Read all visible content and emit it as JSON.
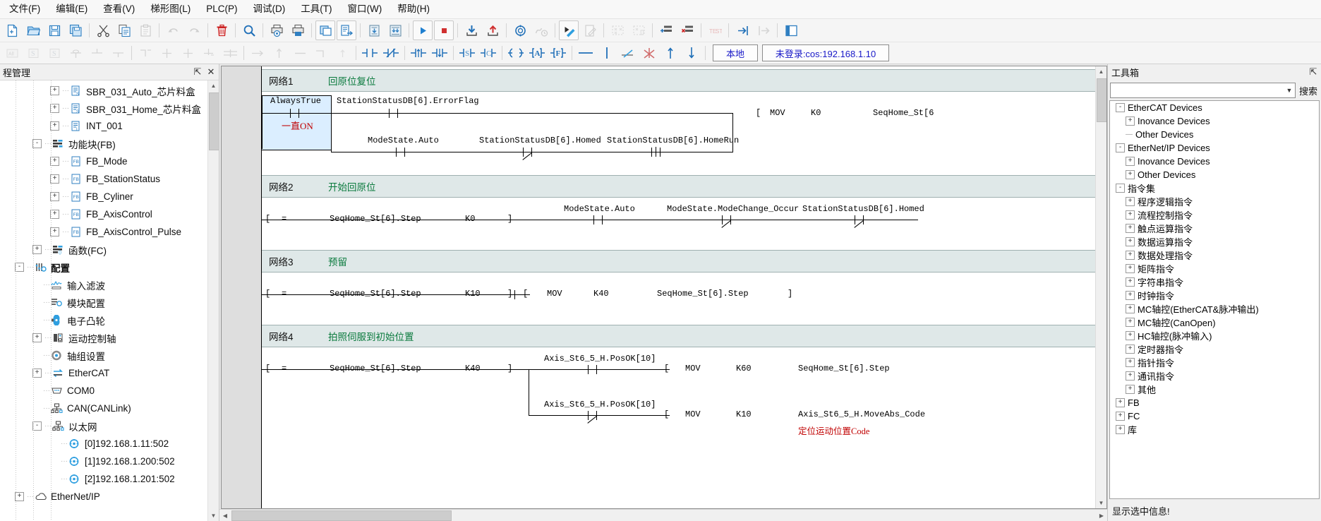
{
  "menu": {
    "items": [
      {
        "label": "文件(F)",
        "name": "menu-file"
      },
      {
        "label": "编辑(E)",
        "name": "menu-edit"
      },
      {
        "label": "查看(V)",
        "name": "menu-view"
      },
      {
        "label": "梯形图(L)",
        "name": "menu-ladder"
      },
      {
        "label": "PLC(P)",
        "name": "menu-plc"
      },
      {
        "label": "调试(D)",
        "name": "menu-debug"
      },
      {
        "label": "工具(T)",
        "name": "menu-tools"
      },
      {
        "label": "窗口(W)",
        "name": "menu-window"
      },
      {
        "label": "帮助(H)",
        "name": "menu-help"
      }
    ]
  },
  "status": {
    "local_label": "本地",
    "connection_label": "未登录:cos:192.168.1.10"
  },
  "left_panel": {
    "title": "程管理",
    "pin_glyph": "⇱",
    "close_glyph": "✕",
    "tree": [
      {
        "label": "SBR_031_Auto_芯片料盒",
        "indent": 3,
        "icon": "subroutine-icon",
        "expander": "+"
      },
      {
        "label": "SBR_031_Home_芯片料盒",
        "indent": 3,
        "icon": "subroutine-icon",
        "expander": "+"
      },
      {
        "label": "INT_001",
        "indent": 3,
        "icon": "interrupt-icon",
        "expander": "+"
      },
      {
        "label": "功能块(FB)",
        "indent": 2,
        "icon": "folder-fb-icon",
        "expander": "-"
      },
      {
        "label": "FB_Mode",
        "indent": 3,
        "icon": "fb-icon",
        "expander": "+"
      },
      {
        "label": "FB_StationStatus",
        "indent": 3,
        "icon": "fb-icon",
        "expander": "+"
      },
      {
        "label": "FB_Cyliner",
        "indent": 3,
        "icon": "fb-icon",
        "expander": "+"
      },
      {
        "label": "FB_AxisControl",
        "indent": 3,
        "icon": "fb-icon",
        "expander": "+"
      },
      {
        "label": "FB_AxisControl_Pulse",
        "indent": 3,
        "icon": "fb-icon",
        "expander": "+"
      },
      {
        "label": "函数(FC)",
        "indent": 2,
        "icon": "folder-fc-icon",
        "expander": "+"
      },
      {
        "label": "配置",
        "indent": 1,
        "icon": "config-icon",
        "expander": "-",
        "bold": true
      },
      {
        "label": "输入滤波",
        "indent": 2,
        "icon": "input-filter-icon",
        "expander": ""
      },
      {
        "label": "模块配置",
        "indent": 2,
        "icon": "module-config-icon",
        "expander": ""
      },
      {
        "label": "电子凸轮",
        "indent": 2,
        "icon": "ecam-icon",
        "expander": ""
      },
      {
        "label": "运动控制轴",
        "indent": 2,
        "icon": "motion-axis-icon",
        "expander": "+"
      },
      {
        "label": "轴组设置",
        "indent": 2,
        "icon": "axis-group-icon",
        "expander": ""
      },
      {
        "label": "EtherCAT",
        "indent": 2,
        "icon": "ethercat-icon",
        "expander": "+"
      },
      {
        "label": "COM0",
        "indent": 2,
        "icon": "serial-port-icon",
        "expander": ""
      },
      {
        "label": "CAN(CANLink)",
        "indent": 2,
        "icon": "can-icon",
        "expander": ""
      },
      {
        "label": "以太网",
        "indent": 2,
        "icon": "ethernet-icon",
        "expander": "-"
      },
      {
        "label": "[0]192.168.1.11:502",
        "indent": 3,
        "icon": "node-icon",
        "expander": ""
      },
      {
        "label": "[1]192.168.1.200:502",
        "indent": 3,
        "icon": "node-icon",
        "expander": ""
      },
      {
        "label": "[2]192.168.1.201:502",
        "indent": 3,
        "icon": "node-icon",
        "expander": ""
      },
      {
        "label": "EtherNet/IP",
        "indent": 1,
        "icon": "ethernetip-icon",
        "expander": "+"
      }
    ]
  },
  "ladder": {
    "networks": [
      {
        "name": "网络1",
        "comment": "回原位复位",
        "elements": {
          "contact_always": "AlwaysTrue",
          "contact_always_note": "一直ON",
          "contact2": "StationStatusDB[6].ErrorFlag",
          "coil_op": "MOV",
          "coil_k": "K0",
          "coil_dest": "SeqHome_St[6",
          "branch1": "ModeState.Auto",
          "branch2": "StationStatusDB[6].Homed",
          "branch3": "StationStatusDB[6].HomeRun"
        }
      },
      {
        "name": "网络2",
        "comment": "开始回原位",
        "elements": {
          "cmp_op": "=",
          "cmp_a": "SeqHome_St[6].Step",
          "cmp_b": "K0",
          "c1": "ModeState.Auto",
          "c2": "ModeState.ModeChange_Occur",
          "c3": "StationStatusDB[6].Homed"
        }
      },
      {
        "name": "网络3",
        "comment": "预留",
        "elements": {
          "cmp_op": "=",
          "cmp_a": "SeqHome_St[6].Step",
          "cmp_b": "K10",
          "mov": "MOV",
          "mov_k": "K40",
          "mov_dest": "SeqHome_St[6].Step"
        }
      },
      {
        "name": "网络4",
        "comment": "拍照伺服到初始位置",
        "elements": {
          "cmp_op": "=",
          "cmp_a": "SeqHome_St[6].Step",
          "cmp_b": "K40",
          "c1": "Axis_St6_5_H.PosOK[10]",
          "mov1": "MOV",
          "mov1_k": "K60",
          "mov1_dest": "SeqHome_St[6].Step",
          "c2": "Axis_St6_5_H.PosOK[10]",
          "mov2": "MOV",
          "mov2_k": "K10",
          "mov2_dest": "Axis_St6_5_H.MoveAbs_Code",
          "mov2_note": "定位运动位置Code"
        }
      }
    ]
  },
  "right_panel": {
    "title": "工具箱",
    "pin_glyph": "⇱",
    "search_value": "",
    "search_placeholder": "",
    "search_button_label": "搜索",
    "tree": [
      {
        "label": "EtherCAT Devices",
        "indent": 0,
        "expander": "-"
      },
      {
        "label": "Inovance Devices",
        "indent": 1,
        "expander": "+"
      },
      {
        "label": "Other Devices",
        "indent": 1,
        "expander": ""
      },
      {
        "label": "EtherNet/IP Devices",
        "indent": 0,
        "expander": "-"
      },
      {
        "label": "Inovance Devices",
        "indent": 1,
        "expander": "+"
      },
      {
        "label": "Other Devices",
        "indent": 1,
        "expander": "+"
      },
      {
        "label": "指令集",
        "indent": 0,
        "expander": "-"
      },
      {
        "label": "程序逻辑指令",
        "indent": 1,
        "expander": "+"
      },
      {
        "label": "流程控制指令",
        "indent": 1,
        "expander": "+"
      },
      {
        "label": "触点运算指令",
        "indent": 1,
        "expander": "+"
      },
      {
        "label": "数据运算指令",
        "indent": 1,
        "expander": "+"
      },
      {
        "label": "数据处理指令",
        "indent": 1,
        "expander": "+"
      },
      {
        "label": "矩阵指令",
        "indent": 1,
        "expander": "+"
      },
      {
        "label": "字符串指令",
        "indent": 1,
        "expander": "+"
      },
      {
        "label": "时钟指令",
        "indent": 1,
        "expander": "+"
      },
      {
        "label": "MC轴控(EtherCAT&脉冲输出)",
        "indent": 1,
        "expander": "+"
      },
      {
        "label": "MC轴控(CanOpen)",
        "indent": 1,
        "expander": "+"
      },
      {
        "label": "HC轴控(脉冲输入)",
        "indent": 1,
        "expander": "+"
      },
      {
        "label": "定时器指令",
        "indent": 1,
        "expander": "+"
      },
      {
        "label": "指针指令",
        "indent": 1,
        "expander": "+"
      },
      {
        "label": "通讯指令",
        "indent": 1,
        "expander": "+"
      },
      {
        "label": "其他",
        "indent": 1,
        "expander": "+"
      },
      {
        "label": "FB",
        "indent": 0,
        "expander": "+"
      },
      {
        "label": "FC",
        "indent": 0,
        "expander": "+"
      },
      {
        "label": "库",
        "indent": 0,
        "expander": "+"
      }
    ],
    "info_text": "显示选中信息!"
  }
}
